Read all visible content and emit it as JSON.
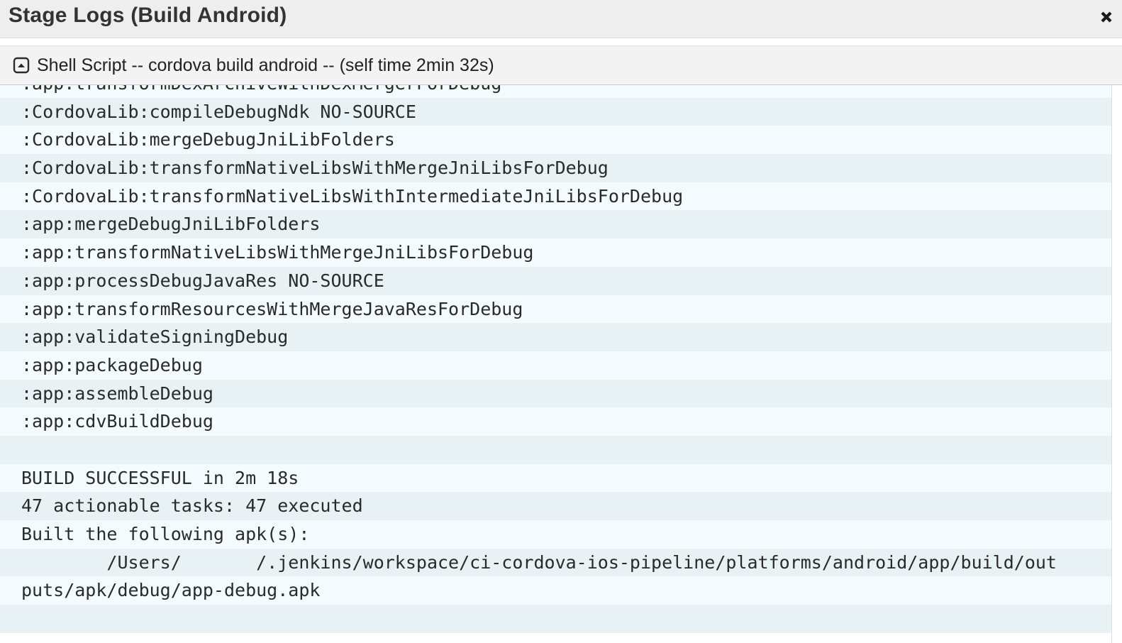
{
  "dialog": {
    "title": "Stage Logs (Build Android)",
    "close_icon": "close-icon"
  },
  "step": {
    "toggle_icon": "collapse-square-icon",
    "title": "Shell Script -- cordova build android -- (self time 2min 32s)"
  },
  "log": {
    "lines": [
      ":app:transformDexArchiveWithDexMergerForDebug",
      ":CordovaLib:compileDebugNdk NO-SOURCE",
      ":CordovaLib:mergeDebugJniLibFolders",
      ":CordovaLib:transformNativeLibsWithMergeJniLibsForDebug",
      ":CordovaLib:transformNativeLibsWithIntermediateJniLibsForDebug",
      ":app:mergeDebugJniLibFolders",
      ":app:transformNativeLibsWithMergeJniLibsForDebug",
      ":app:processDebugJavaRes NO-SOURCE",
      ":app:transformResourcesWithMergeJavaResForDebug",
      ":app:validateSigningDebug",
      ":app:packageDebug",
      ":app:assembleDebug",
      ":app:cdvBuildDebug",
      "",
      "BUILD SUCCESSFUL in 2m 18s",
      "47 actionable tasks: 47 executed",
      "Built the following apk(s):",
      "        /Users/       /.jenkins/workspace/ci-cordova-ios-pipeline/platforms/android/app/build/out",
      "puts/apk/debug/app-debug.apk",
      ""
    ]
  },
  "colors": {
    "row_odd": "#f3fbfe",
    "row_even": "#e8f1f3",
    "header_bg": "#eeeeee",
    "step_bg": "#f3f3f3"
  }
}
